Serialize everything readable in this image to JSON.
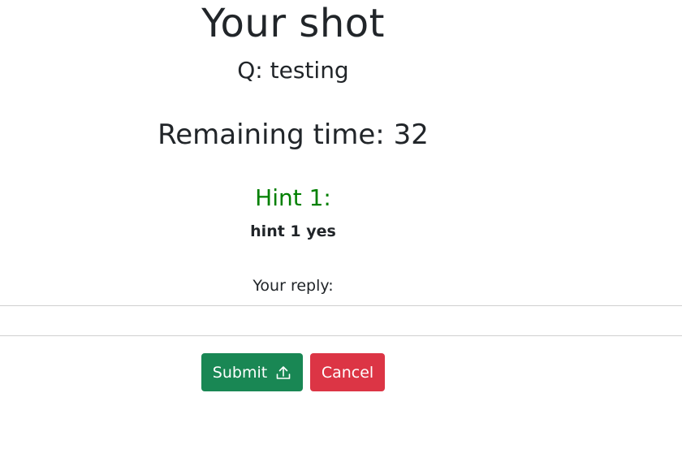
{
  "page": {
    "title": "Your shot",
    "question": "Q: testing",
    "timer": "Remaining time: 32"
  },
  "hint": {
    "title": "Hint 1:",
    "text": "hint 1 yes",
    "color": "#008000"
  },
  "reply": {
    "label": "Your reply:",
    "value": "",
    "placeholder": ""
  },
  "actions": {
    "submit_label": "Submit",
    "submit_icon": "upload-icon",
    "cancel_label": "Cancel",
    "submit_color": "#198754",
    "cancel_color": "#dc3545"
  }
}
